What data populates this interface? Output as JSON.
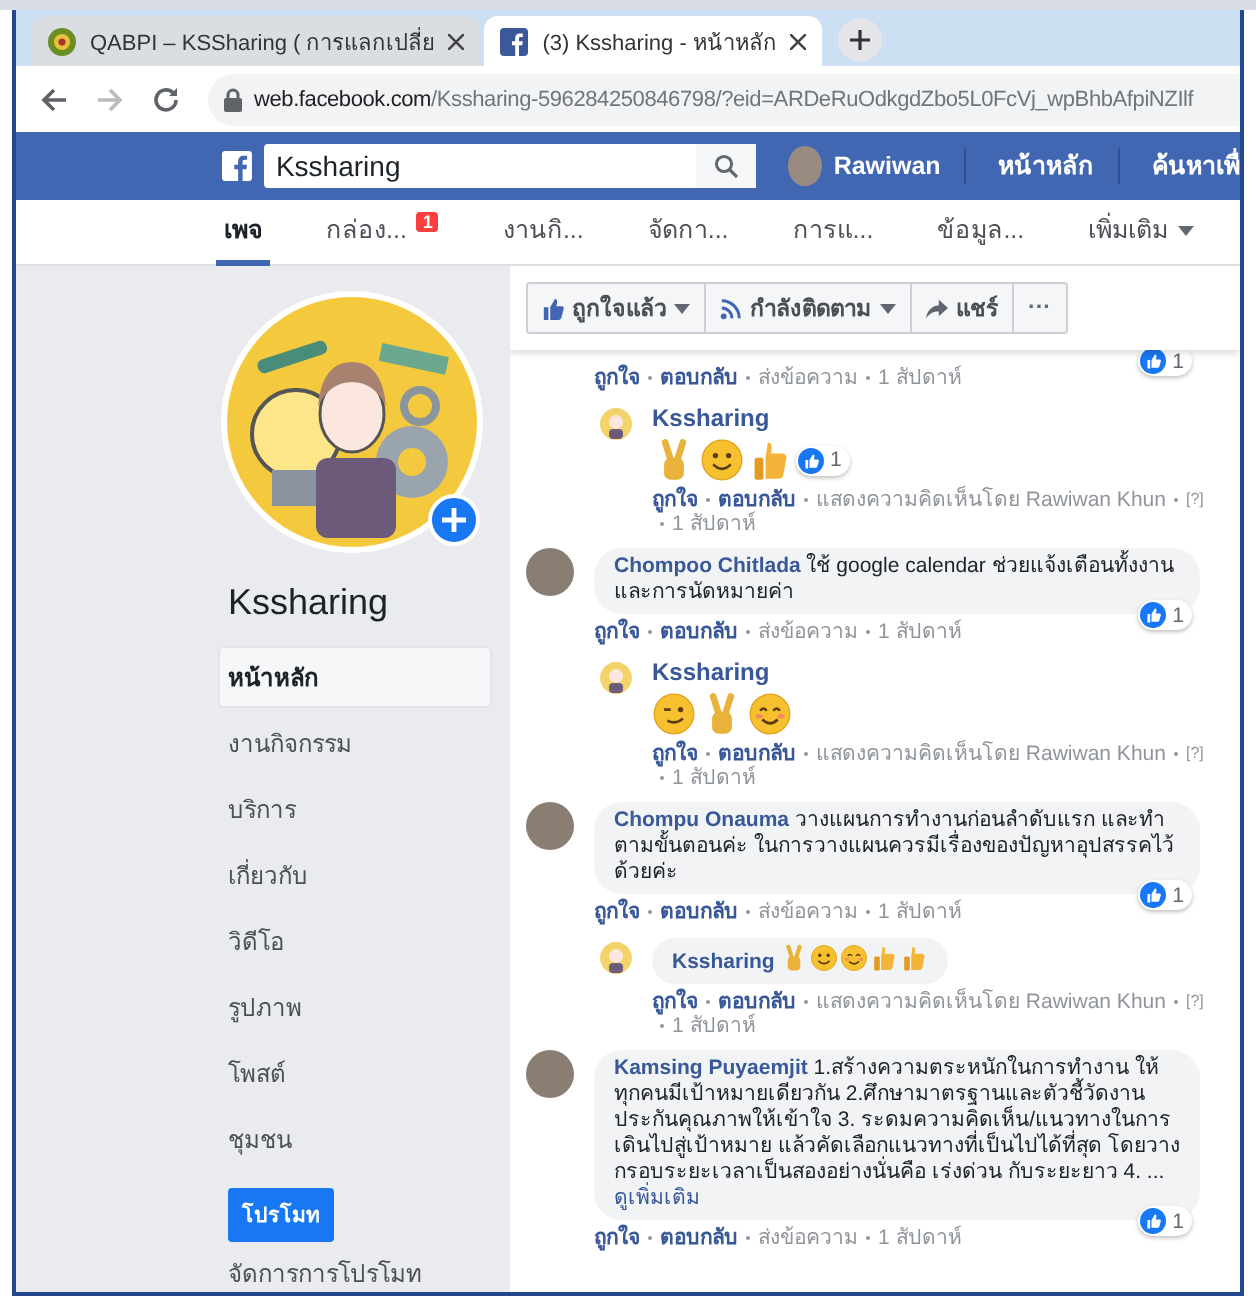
{
  "browser": {
    "tabs": [
      {
        "title": "QABPI – KSSharing ( การแลกเปลี่ย",
        "kind": "site",
        "selected": false
      },
      {
        "title": "(3) Kssharing - หน้าหลัก",
        "kind": "facebook",
        "selected": true
      }
    ],
    "url_host": "web.facebook.com",
    "url_path": "/Kssharing-596284250846798/?eid=ARDeRuOdkgdZbo5L0FcVj_wpBhbAfpiNZIlf"
  },
  "topbar": {
    "search_value": "Kssharing",
    "user": "Rawiwan",
    "links": [
      "หน้าหลัก",
      "ค้นหาเพื่"
    ]
  },
  "page_nav": [
    {
      "label": "เพจ",
      "selected": true
    },
    {
      "label": "กล่อง...",
      "selected": false,
      "badge": "1"
    },
    {
      "label": "งานกิ...",
      "selected": false
    },
    {
      "label": "จัดกา...",
      "selected": false
    },
    {
      "label": "การแ...",
      "selected": false
    },
    {
      "label": "ข้อมูล...",
      "selected": false
    },
    {
      "label": "เพิ่มเติม",
      "selected": false,
      "dropdown": true
    }
  ],
  "sidebar": {
    "page_name": "Kssharing",
    "items": [
      {
        "label": "หน้าหลัก",
        "selected": true
      },
      {
        "label": "งานกิจกรรม",
        "selected": false
      },
      {
        "label": "บริการ",
        "selected": false
      },
      {
        "label": "เกี่ยวกับ",
        "selected": false
      },
      {
        "label": "วิดีโอ",
        "selected": false
      },
      {
        "label": "รูปภาพ",
        "selected": false
      },
      {
        "label": "โพสต์",
        "selected": false
      },
      {
        "label": "ชุมชน",
        "selected": false
      }
    ],
    "promote_button": "โปรโมท",
    "manage_link": "จัดการการโปรโมท"
  },
  "page_actions": [
    {
      "kind": "like",
      "label": "ถูกใจแล้ว",
      "dropdown": true
    },
    {
      "kind": "follow",
      "label": "กำลังติดตาม",
      "dropdown": true
    },
    {
      "kind": "share",
      "label": "แชร์",
      "dropdown": false
    },
    {
      "kind": "more",
      "label": "···",
      "dropdown": false
    }
  ],
  "comments": [
    {
      "kind": "partial",
      "likes": "1",
      "actions": [
        {
          "text": "ถูกใจ",
          "kind": "link"
        },
        {
          "text": "ตอบกลับ",
          "kind": "link"
        },
        {
          "text": "ส่งข้อความ",
          "kind": "info"
        },
        {
          "text": "1 สัปดาห์",
          "kind": "info"
        }
      ]
    },
    {
      "kind": "reply",
      "author": "Kssharing",
      "emojis": [
        {
          "kind": "victory"
        },
        {
          "kind": "smile"
        },
        {
          "kind": "thumbs-up"
        }
      ],
      "likes": "1",
      "actions": [
        {
          "text": "ถูกใจ",
          "kind": "link"
        },
        {
          "text": "ตอบกลับ",
          "kind": "link"
        },
        {
          "text": "แสดงความคิดเห็นโดย Rawiwan Khun",
          "kind": "info"
        },
        {
          "text": "[?]",
          "kind": "help"
        },
        {
          "text": "1 สัปดาห์",
          "kind": "info"
        }
      ]
    },
    {
      "kind": "comment",
      "author": "Chompoo Chitlada",
      "text": "ใช้ google calendar ช่วยแจ้งเตือนทั้งงานและการนัดหมายค่า",
      "likes": "1",
      "actions": [
        {
          "text": "ถูกใจ",
          "kind": "link"
        },
        {
          "text": "ตอบกลับ",
          "kind": "link"
        },
        {
          "text": "ส่งข้อความ",
          "kind": "info"
        },
        {
          "text": "1 สัปดาห์",
          "kind": "info"
        }
      ]
    },
    {
      "kind": "reply",
      "author": "Kssharing",
      "emojis": [
        {
          "kind": "wink"
        },
        {
          "kind": "victory"
        },
        {
          "kind": "blush"
        }
      ],
      "actions": [
        {
          "text": "ถูกใจ",
          "kind": "link"
        },
        {
          "text": "ตอบกลับ",
          "kind": "link"
        },
        {
          "text": "แสดงความคิดเห็นโดย Rawiwan Khun",
          "kind": "info"
        },
        {
          "text": "[?]",
          "kind": "help"
        },
        {
          "text": "1 สัปดาห์",
          "kind": "info"
        }
      ]
    },
    {
      "kind": "comment",
      "author": "Chompu Onauma",
      "text": "วางแผนการทำงานก่อนลำดับแรก และทำตามขั้นตอนค่ะ ในการวางแผนควรมีเรื่องของปัญหาอุปสรรคไว้ด้วยค่ะ",
      "likes": "1",
      "actions": [
        {
          "text": "ถูกใจ",
          "kind": "link"
        },
        {
          "text": "ตอบกลับ",
          "kind": "link"
        },
        {
          "text": "ส่งข้อความ",
          "kind": "info"
        },
        {
          "text": "1 สัปดาห์",
          "kind": "info"
        }
      ]
    },
    {
      "kind": "reply-inline",
      "author": "Kssharing",
      "emojis": [
        {
          "kind": "victory"
        },
        {
          "kind": "smile"
        },
        {
          "kind": "blush"
        },
        {
          "kind": "thumbs-up"
        },
        {
          "kind": "thumbs-up"
        }
      ],
      "actions": [
        {
          "text": "ถูกใจ",
          "kind": "link"
        },
        {
          "text": "ตอบกลับ",
          "kind": "link"
        },
        {
          "text": "แสดงความคิดเห็นโดย Rawiwan Khun",
          "kind": "info"
        },
        {
          "text": "[?]",
          "kind": "help"
        },
        {
          "text": "1 สัปดาห์",
          "kind": "info"
        }
      ]
    },
    {
      "kind": "comment",
      "author": "Kamsing Puyaemjit",
      "text": "1.สร้างความตระหนักในการทำงาน ให้ทุกคนมีเป้าหมายเดียวกัน 2.ศึกษามาตรฐานและตัวชี้วัดงานประกันคุณภาพให้เข้าใจ 3. ระดมความคิดเห็น/แนวทางในการเดินไปสู่เป้าหมาย แล้วคัดเลือกแนวทางที่เป็นไปได้ที่สุด โดยวางกรอบระยะเวลาเป็นสองอย่างนั่นคือ เร่งด่วน กับระยะยาว 4. ...",
      "see_more": "ดูเพิ่มเติม",
      "likes": "1",
      "actions": [
        {
          "text": "ถูกใจ",
          "kind": "link"
        },
        {
          "text": "ตอบกลับ",
          "kind": "link"
        },
        {
          "text": "ส่งข้อความ",
          "kind": "info"
        },
        {
          "text": "1 สัปดาห์",
          "kind": "info"
        }
      ]
    }
  ]
}
